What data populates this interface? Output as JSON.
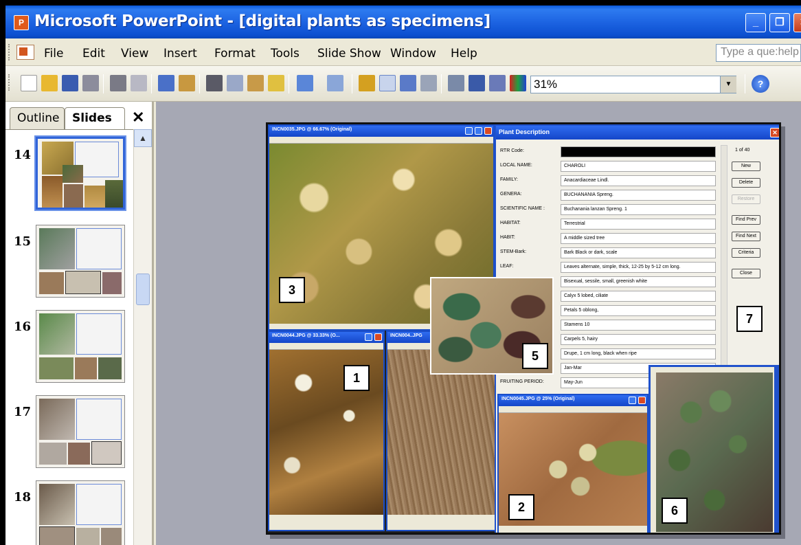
{
  "window": {
    "title": "Microsoft PowerPoint - [digital plants as specimens]",
    "app_icon": "powerpoint-icon",
    "controls": [
      "minimize-icon",
      "restore-icon",
      "close-icon"
    ]
  },
  "menu": {
    "items": [
      "File",
      "Edit",
      "View",
      "Insert",
      "Format",
      "Tools",
      "Slide Show",
      "Window",
      "Help"
    ],
    "help_placeholder": "Type a question for help",
    "help_visible": "Type a que:help"
  },
  "toolbar": {
    "zoom": "31%",
    "icons": [
      "new-icon",
      "open-icon",
      "save-icon",
      "permission-icon",
      "print-icon",
      "print-preview-icon",
      "spelling-icon",
      "research-icon",
      "cut-icon",
      "copy-icon",
      "paste-icon",
      "format-painter-icon",
      "undo-icon",
      "redo-icon",
      "insert-chart-icon",
      "insert-table-icon",
      "tables-borders-icon",
      "hyperlink-icon",
      "expand-all-icon",
      "show-formatting-icon",
      "grid-icon",
      "color-grayscale-icon",
      "help-icon"
    ]
  },
  "left_pane": {
    "tabs": [
      "Outline",
      "Slides"
    ],
    "active_tab": "Slides",
    "slides": [
      "14",
      "15",
      "16",
      "17",
      "18"
    ],
    "selected_slide": "14"
  },
  "slide": {
    "labels": [
      "3",
      "1",
      "5",
      "7",
      "2",
      "6"
    ],
    "windows": {
      "top_image_title": "INCN0035.JPG @ 66.67% (Original)",
      "image1_title": "INCN0044.JPG @ 33.33% (O...",
      "image_bark_title": "INCN004..JPG",
      "image2_title": "INCN0045.JPG @ 25% (Original)"
    },
    "form": {
      "title": "Plant Description",
      "counter": "1 of 40",
      "fields": [
        {
          "label": "RTR Code:",
          "value": ""
        },
        {
          "label": "LOCAL NAME:",
          "value": "CHAROLI"
        },
        {
          "label": "FAMILY:",
          "value": "Anacardiaceae Lindl."
        },
        {
          "label": "GENERA:",
          "value": "BUCHANANIA Spreng."
        },
        {
          "label": "SCIENTIFIC NAME :",
          "value": "Buchanania lanzan Spreng. 1"
        },
        {
          "label": "HABITAT:",
          "value": "Terrestrial"
        },
        {
          "label": "HABIT:",
          "value": "A middle sized tree"
        },
        {
          "label": "STEM-Bark:",
          "value": "Bark Black or dark, scale"
        },
        {
          "label": "LEAF:",
          "value": "Leaves alternate, simple, thick, 12-25 by 5-12 cm long."
        },
        {
          "label": "",
          "value": "Bisexual, sessile, small, greenish white"
        },
        {
          "label": "",
          "value": "Calyx 5 lobed, ciliate"
        },
        {
          "label": "",
          "value": "Petals 5 oblong,"
        },
        {
          "label": "",
          "value": "Stamens 10"
        },
        {
          "label": "",
          "value": "Carpels 5, hairy"
        },
        {
          "label": "",
          "value": "Drupe, 1 cm long, black when ripe"
        },
        {
          "label": "",
          "value": "Jan-Mar"
        },
        {
          "label": "FRUITING PERIOD:",
          "value": "May-Jun"
        }
      ],
      "buttons": [
        "New",
        "Delete",
        "Restore",
        "Find Prev",
        "Find Next",
        "Criteria",
        "Close"
      ]
    }
  }
}
